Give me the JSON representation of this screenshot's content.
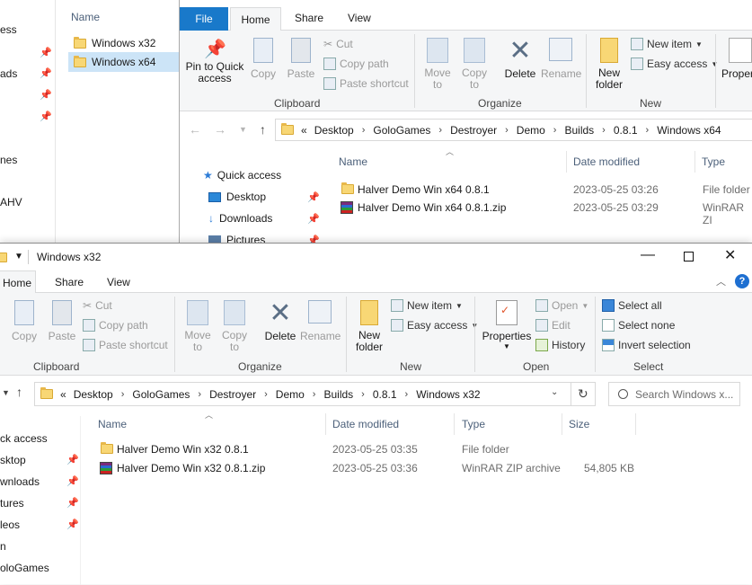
{
  "back_window": {
    "left_nav_partial": [
      "ess",
      "ads",
      "nes",
      "AHV"
    ],
    "folder_list": {
      "header": "Name",
      "items": [
        {
          "label": "Windows x32",
          "selected": false
        },
        {
          "label": "Windows x64",
          "selected": true
        }
      ]
    },
    "tabs": [
      "File",
      "Home",
      "Share",
      "View"
    ],
    "ribbon": {
      "clipboard": {
        "pin_label": "Pin to Quick access",
        "copy": "Copy",
        "paste": "Paste",
        "cut": "Cut",
        "copy_path": "Copy path",
        "paste_shortcut": "Paste shortcut",
        "group": "Clipboard"
      },
      "organize": {
        "move_to": "Move to",
        "copy_to": "Copy to",
        "delete": "Delete",
        "rename": "Rename",
        "group": "Organize"
      },
      "new": {
        "new_folder": "New folder",
        "new_item": "New item",
        "easy_access": "Easy access",
        "group": "New"
      },
      "open": {
        "properties_partial": "Proper"
      }
    },
    "breadcrumb": [
      "Desktop",
      "GoloGames",
      "Destroyer",
      "Demo",
      "Builds",
      "0.8.1",
      "Windows x64"
    ],
    "breadcrumb_prefix": "«",
    "nav": {
      "quick_access": "Quick access",
      "desktop": "Desktop",
      "downloads": "Downloads",
      "pictures": "Pictures"
    },
    "columns": {
      "name": "Name",
      "date": "Date modified",
      "type": "Type"
    },
    "files": [
      {
        "name": "Halver Demo Win x64 0.8.1",
        "date": "2023-05-25 03:26",
        "type": "File folder",
        "kind": "folder"
      },
      {
        "name": "Halver Demo Win x64 0.8.1.zip",
        "date": "2023-05-25 03:29",
        "type": "WinRAR ZI",
        "kind": "zip"
      }
    ]
  },
  "front_window": {
    "title": "Windows x32",
    "tabs": [
      "Home",
      "Share",
      "View"
    ],
    "ribbon": {
      "clipboard": {
        "copy": "Copy",
        "paste": "Paste",
        "cut": "Cut",
        "copy_path": "Copy path",
        "paste_shortcut": "Paste shortcut",
        "group": "Clipboard"
      },
      "organize": {
        "move_to": "Move to",
        "copy_to": "Copy to",
        "delete": "Delete",
        "rename": "Rename",
        "group": "Organize"
      },
      "new": {
        "new_folder": "New folder",
        "new_item": "New item",
        "easy_access": "Easy access",
        "group": "New"
      },
      "open": {
        "properties": "Properties",
        "open": "Open",
        "edit": "Edit",
        "history": "History",
        "group": "Open"
      },
      "select": {
        "select_all": "Select all",
        "select_none": "Select none",
        "invert": "Invert selection",
        "group": "Select"
      }
    },
    "breadcrumb": [
      "Desktop",
      "GoloGames",
      "Destroyer",
      "Demo",
      "Builds",
      "0.8.1",
      "Windows x32"
    ],
    "breadcrumb_prefix": "«",
    "search_placeholder": "Search Windows x...",
    "nav_partial": [
      "ck access",
      "sktop",
      "wnloads",
      "tures",
      "leos",
      "n",
      "oloGames"
    ],
    "columns": {
      "name": "Name",
      "date": "Date modified",
      "type": "Type",
      "size": "Size"
    },
    "files": [
      {
        "name": "Halver Demo Win x32 0.8.1",
        "date": "2023-05-25 03:35",
        "type": "File folder",
        "size": "",
        "kind": "folder"
      },
      {
        "name": "Halver Demo Win x32 0.8.1.zip",
        "date": "2023-05-25 03:36",
        "type": "WinRAR ZIP archive",
        "size": "54,805 KB",
        "kind": "zip"
      }
    ]
  }
}
